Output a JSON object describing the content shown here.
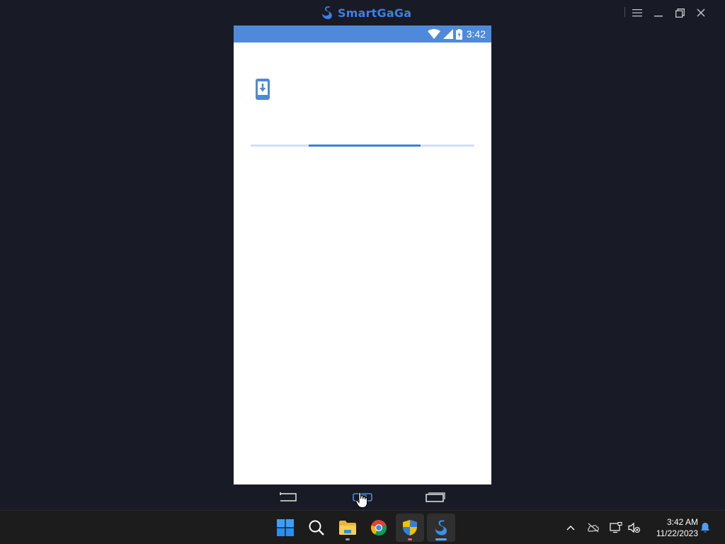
{
  "window": {
    "app_name": "SmartGaGa",
    "brand_color": "#3d7fe6",
    "controls": [
      "menu-icon",
      "minimize-icon",
      "restore-icon",
      "close-icon"
    ]
  },
  "android": {
    "status_bar": {
      "time": "3:42",
      "background": "#4e8ad9",
      "icons": [
        "wifi-icon",
        "signal-icon",
        "battery-charging-icon"
      ]
    },
    "screen": {
      "icon": "phone-download-icon",
      "progress": {
        "indeterminate": true,
        "segment_start": 0.26,
        "segment_end": 0.76
      }
    },
    "nav_bar": [
      "back-icon",
      "home-icon",
      "recents-icon"
    ]
  },
  "taskbar": {
    "apps": [
      {
        "name": "start",
        "icon": "windows-logo-icon"
      },
      {
        "name": "search",
        "icon": "search-icon"
      },
      {
        "name": "file-explorer",
        "icon": "folder-icon"
      },
      {
        "name": "chrome",
        "icon": "chrome-icon"
      },
      {
        "name": "security",
        "icon": "shield-icon"
      },
      {
        "name": "smartgaga",
        "icon": "swan-icon"
      }
    ],
    "tray": {
      "icons": [
        "chevron-up-icon",
        "cloud-offline-icon",
        "network-icon",
        "volume-muted-icon"
      ],
      "time": "3:42 AM",
      "date": "11/22/2023",
      "notification_icon": "bell-icon"
    }
  }
}
